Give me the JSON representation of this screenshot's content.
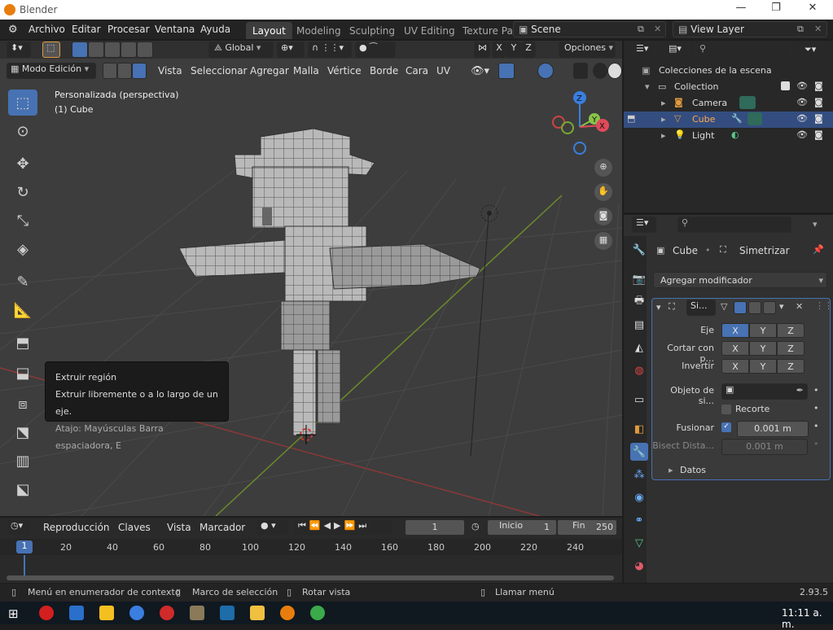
{
  "window": {
    "title": "Blender",
    "minimize": "—",
    "maximize": "❐",
    "close": "✕"
  },
  "menu": [
    "Archivo",
    "Editar",
    "Procesar",
    "Ventana",
    "Ayuda"
  ],
  "workspace_tabs": [
    "Layout",
    "Modeling",
    "Sculpting",
    "UV Editing",
    "Texture Pa"
  ],
  "scene": {
    "name": "Scene",
    "view_layer": "View Layer"
  },
  "viewport_header": {
    "transform": "Global",
    "axis_x": "X",
    "axis_y": "Y",
    "axis_z": "Z",
    "options": "Opciones",
    "mode": "Modo Edición",
    "menus": [
      "Vista",
      "Seleccionar",
      "Agregar",
      "Malla",
      "Vértice",
      "Borde",
      "Cara",
      "UV"
    ]
  },
  "viewport": {
    "view_name": "Personalizada (perspectiva)",
    "object_name": "(1) Cube",
    "gizmo_x": "X",
    "gizmo_y": "Y",
    "gizmo_z": "Z"
  },
  "tooltip": {
    "title": "Extruir región",
    "description": "Extruir libremente o a lo largo de un eje.",
    "shortcut": "Atajo: Mayúsculas Barra espaciadora, E"
  },
  "timeline": {
    "menus": [
      "Reproducción",
      "Claves",
      "Vista",
      "Marcador"
    ],
    "current_frame": "1",
    "start_label": "Inicio",
    "start": "1",
    "end_label": "Fin",
    "end": "250",
    "ruler": [
      "1",
      "20",
      "40",
      "60",
      "80",
      "100",
      "120",
      "140",
      "160",
      "180",
      "200",
      "220",
      "240"
    ]
  },
  "outliner": {
    "root": "Colecciones de la escena",
    "collection": "Collection",
    "items": [
      "Camera",
      "Cube",
      "Light"
    ]
  },
  "properties": {
    "object": "Cube",
    "modifier_name": "Simetrizar",
    "add_modifier": "Agregar modificador",
    "modifier_short": "Si...",
    "rows": [
      {
        "label": "Eje",
        "x": "X",
        "y": "Y",
        "z": "Z"
      },
      {
        "label": "Cortar con p...",
        "x": "X",
        "y": "Y",
        "z": "Z"
      },
      {
        "label": "Invertir",
        "x": "X",
        "y": "Y",
        "z": "Z"
      }
    ],
    "mirror_object_label": "Objeto de si...",
    "clip_label": "Recorte",
    "merge_label": "Fusionar",
    "merge_value": "0.001 m",
    "bisect_label": "Bisect Dista...",
    "bisect_value": "0.001 m",
    "data_label": "Datos"
  },
  "statusbar": {
    "left1": "Menú en enumerador de contexto",
    "left2": "Marco de selección",
    "left3": "Rotar vista",
    "center": "Llamar menú",
    "version": "2.93.5"
  },
  "taskbar": {
    "clock": "11:11 a. m."
  },
  "colors": {
    "accent": "#4772b3",
    "grid_x": "#8b3838",
    "grid_y": "#6b8b2a",
    "orange": "#e09b3d"
  }
}
